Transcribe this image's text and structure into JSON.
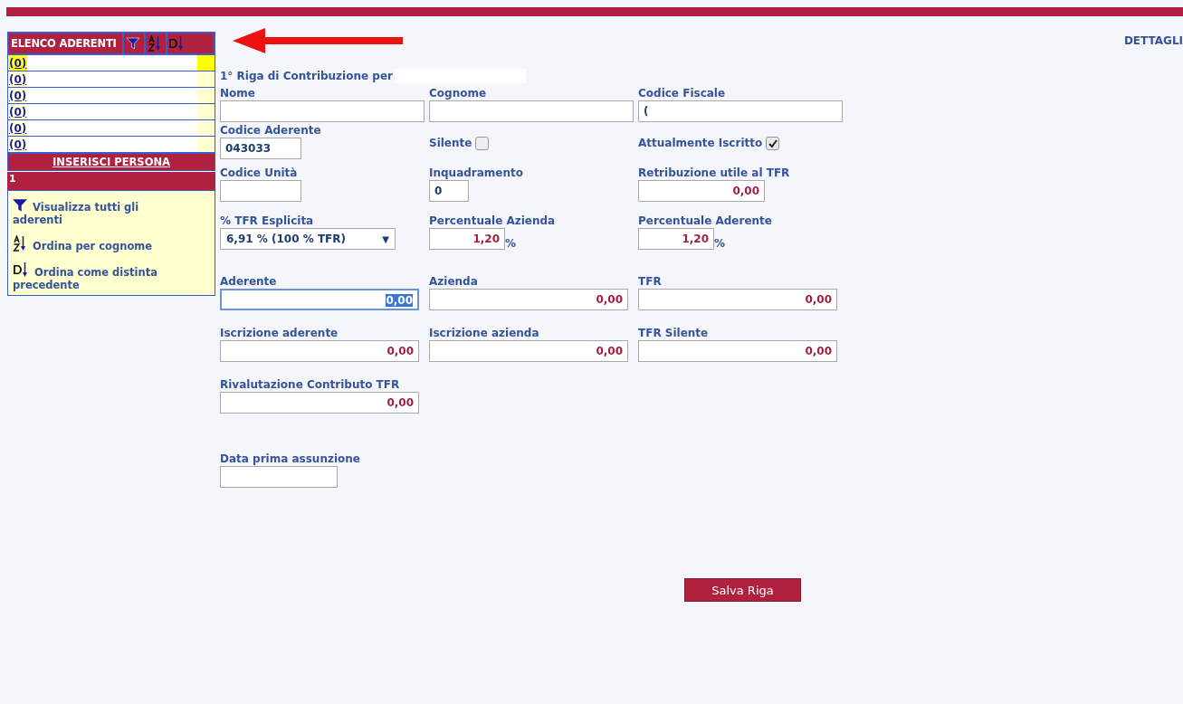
{
  "sidebar": {
    "title": "ELENCO ADERENTI",
    "tools": [
      {
        "kind": "filter"
      },
      {
        "kind": "az"
      },
      {
        "kind": "d"
      }
    ],
    "items": [
      {
        "label": "(0)",
        "selected": true
      },
      {
        "label": "(0)",
        "selected": false
      },
      {
        "label": "(0)",
        "selected": false
      },
      {
        "label": "(0)",
        "selected": false
      },
      {
        "label": "(0)",
        "selected": false
      },
      {
        "label": "(0)",
        "selected": false
      }
    ],
    "insert_button": "INSERISCI PERSONA",
    "page": "1",
    "legend": [
      {
        "kind": "filter",
        "text": "Visualizza tutti gli aderenti"
      },
      {
        "kind": "az",
        "text": "Ordina per cognome"
      },
      {
        "kind": "d",
        "text": "Ordina come distinta precedente"
      }
    ]
  },
  "details_link": "DETTAGLI",
  "form": {
    "title": "1° Riga di Contribuzione per",
    "rows": [
      [
        {
          "label": "Nome",
          "kind": "text"
        },
        {
          "label": "Cognome",
          "kind": "text"
        },
        {
          "label": "Codice Fiscale",
          "kind": "text",
          "value": "("
        }
      ],
      [
        {
          "label": "Codice Aderente",
          "kind": "code",
          "value": "043033"
        },
        {
          "label": "Silente",
          "kind": "checkbox",
          "checked": false
        },
        {
          "label": "Attualmente Iscritto",
          "kind": "checkbox",
          "checked": true
        }
      ],
      [
        {
          "label": "Codice Unità",
          "kind": "code"
        },
        {
          "label": "Inquadramento",
          "kind": "number",
          "value": "0"
        },
        {
          "label": "Retribuzione utile al TFR",
          "kind": "salary",
          "value": "0,00"
        }
      ],
      [
        {
          "label": "% TFR Esplicita",
          "kind": "select",
          "value": "6,91 % (100 % TFR)",
          "arrow": "▼"
        },
        {
          "label": "Percentuale Azienda",
          "kind": "percent",
          "value": "1,20",
          "suffix": "%"
        },
        {
          "label": "Percentuale Aderente",
          "kind": "percent",
          "value": "1,20",
          "suffix": "%"
        }
      ],
      [
        {
          "label": "Aderente",
          "kind": "money",
          "value": "0,00",
          "focused": true
        },
        {
          "label": "Azienda",
          "kind": "money",
          "value": "0,00",
          "focused": false
        },
        {
          "label": "TFR",
          "kind": "money",
          "value": "0,00",
          "focused": false
        }
      ],
      [
        {
          "label": "Iscrizione aderente",
          "kind": "money",
          "value": "0,00",
          "focused": false
        },
        {
          "label": "Iscrizione azienda",
          "kind": "money",
          "value": "0,00",
          "focused": false
        },
        {
          "label": "TFR Silente",
          "kind": "money",
          "value": "0,00",
          "focused": false
        }
      ],
      [
        {
          "label": "Rivalutazione Contributo TFR",
          "kind": "money",
          "value": "0,00",
          "focused": false
        }
      ],
      [
        {
          "label": "Data prima assunzione",
          "kind": "date"
        }
      ]
    ],
    "save_button": "Salva Riga"
  }
}
